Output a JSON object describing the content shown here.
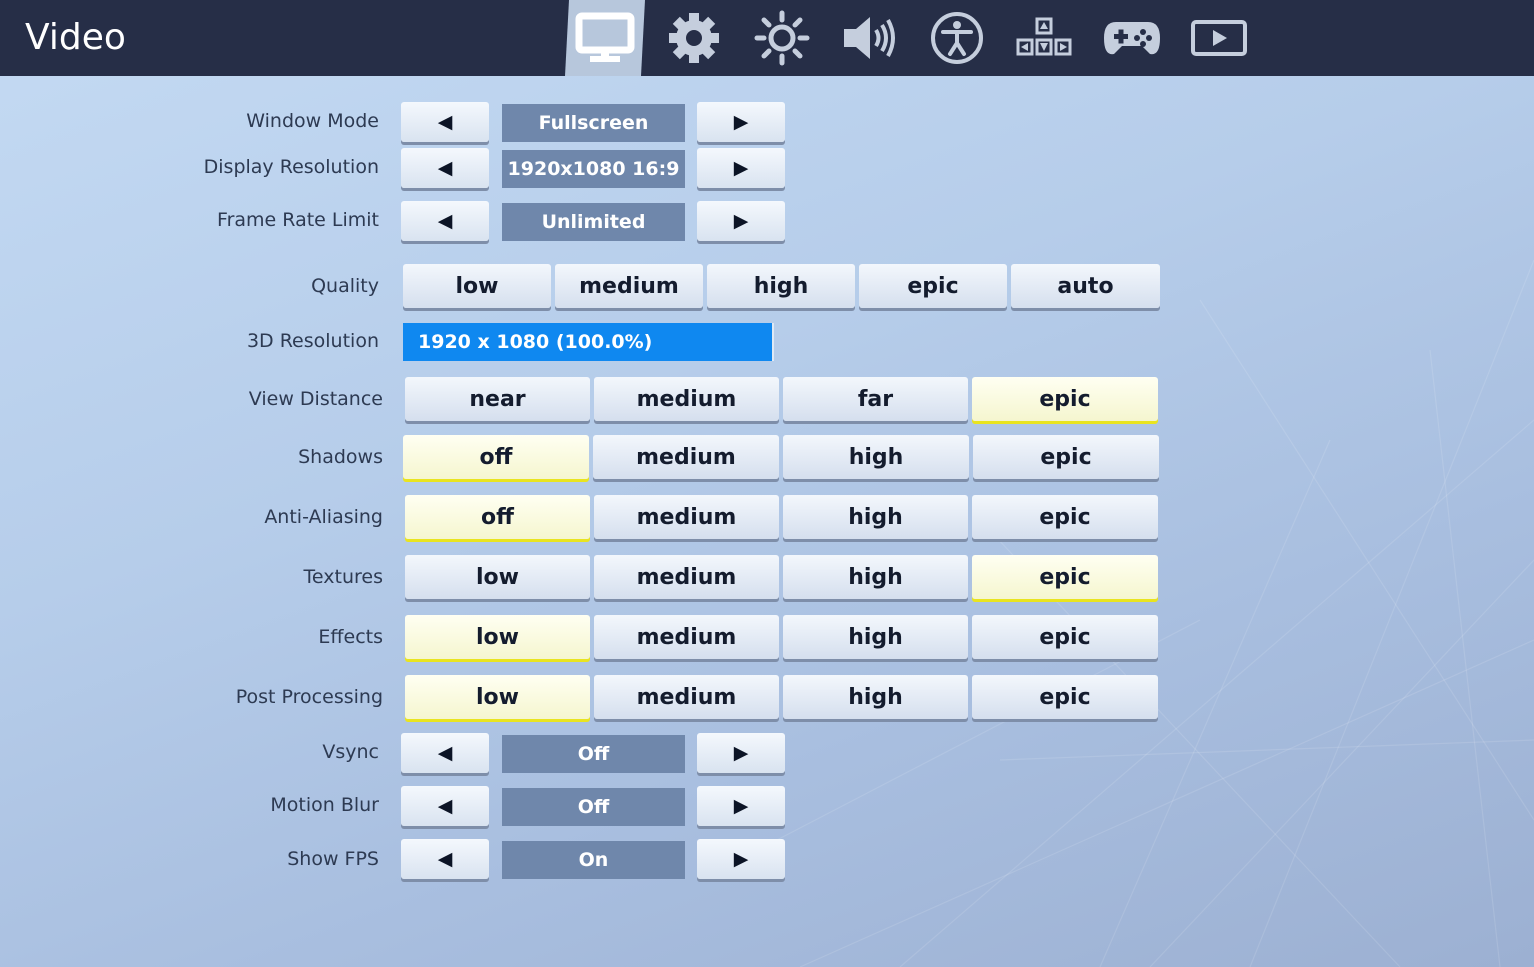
{
  "header": {
    "title": "Video",
    "tabs": [
      {
        "icon": "monitor-icon",
        "active": true
      },
      {
        "icon": "gear-icon",
        "active": false
      },
      {
        "icon": "brightness-icon",
        "active": false
      },
      {
        "icon": "speaker-icon",
        "active": false
      },
      {
        "icon": "accessibility-icon",
        "active": false
      },
      {
        "icon": "input-keys-icon",
        "active": false
      },
      {
        "icon": "gamepad-icon",
        "active": false
      },
      {
        "icon": "replay-icon",
        "active": false
      }
    ]
  },
  "colors": {
    "topbar": "#262e47",
    "active_tab": "#b7c7dc",
    "value_box": "#6f87ab",
    "resolution_bar": "#0f88f0",
    "selected_underline": "#e9e41f"
  },
  "arrows": {
    "left": "◀",
    "right": "▶"
  },
  "window_mode": {
    "label": "Window Mode",
    "value": "Fullscreen"
  },
  "display_resolution": {
    "label": "Display Resolution",
    "value": "1920x1080 16:9"
  },
  "frame_rate_limit": {
    "label": "Frame Rate Limit",
    "value": "Unlimited"
  },
  "quality": {
    "label": "Quality",
    "options": [
      "low",
      "medium",
      "high",
      "epic",
      "auto"
    ]
  },
  "resolution_3d": {
    "label": "3D Resolution",
    "value": "1920 x 1080 (100.0%)",
    "percent": 100
  },
  "view_distance": {
    "label": "View Distance",
    "options": [
      "near",
      "medium",
      "far",
      "epic"
    ],
    "selected": "epic"
  },
  "shadows": {
    "label": "Shadows",
    "options": [
      "off",
      "medium",
      "high",
      "epic"
    ],
    "selected": "off"
  },
  "anti_aliasing": {
    "label": "Anti-Aliasing",
    "options": [
      "off",
      "medium",
      "high",
      "epic"
    ],
    "selected": "off"
  },
  "textures": {
    "label": "Textures",
    "options": [
      "low",
      "medium",
      "high",
      "epic"
    ],
    "selected": "epic"
  },
  "effects": {
    "label": "Effects",
    "options": [
      "low",
      "medium",
      "high",
      "epic"
    ],
    "selected": "low"
  },
  "post_processing": {
    "label": "Post Processing",
    "options": [
      "low",
      "medium",
      "high",
      "epic"
    ],
    "selected": "low"
  },
  "vsync": {
    "label": "Vsync",
    "value": "Off"
  },
  "motion_blur": {
    "label": "Motion Blur",
    "value": "Off"
  },
  "show_fps": {
    "label": "Show FPS",
    "value": "On"
  }
}
